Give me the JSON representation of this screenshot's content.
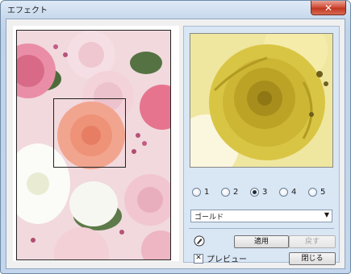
{
  "window": {
    "title": "エフェクト",
    "close_glyph": "✕"
  },
  "effect_levels": [
    "1",
    "2",
    "3",
    "4",
    "5"
  ],
  "selected_level": "3",
  "style_select": {
    "value": "ゴールド"
  },
  "buttons": {
    "apply": "適用",
    "revert": "戻す",
    "close": "閉じる"
  },
  "preview_checkbox": {
    "label": "プレビュー",
    "checked": true
  },
  "icons": {
    "tool": "paintbrush-icon"
  },
  "colors": {
    "accent_window": "#c3d6ec",
    "gold_preview": "#d8c33a",
    "panel_bg": "#d9e6f4"
  }
}
